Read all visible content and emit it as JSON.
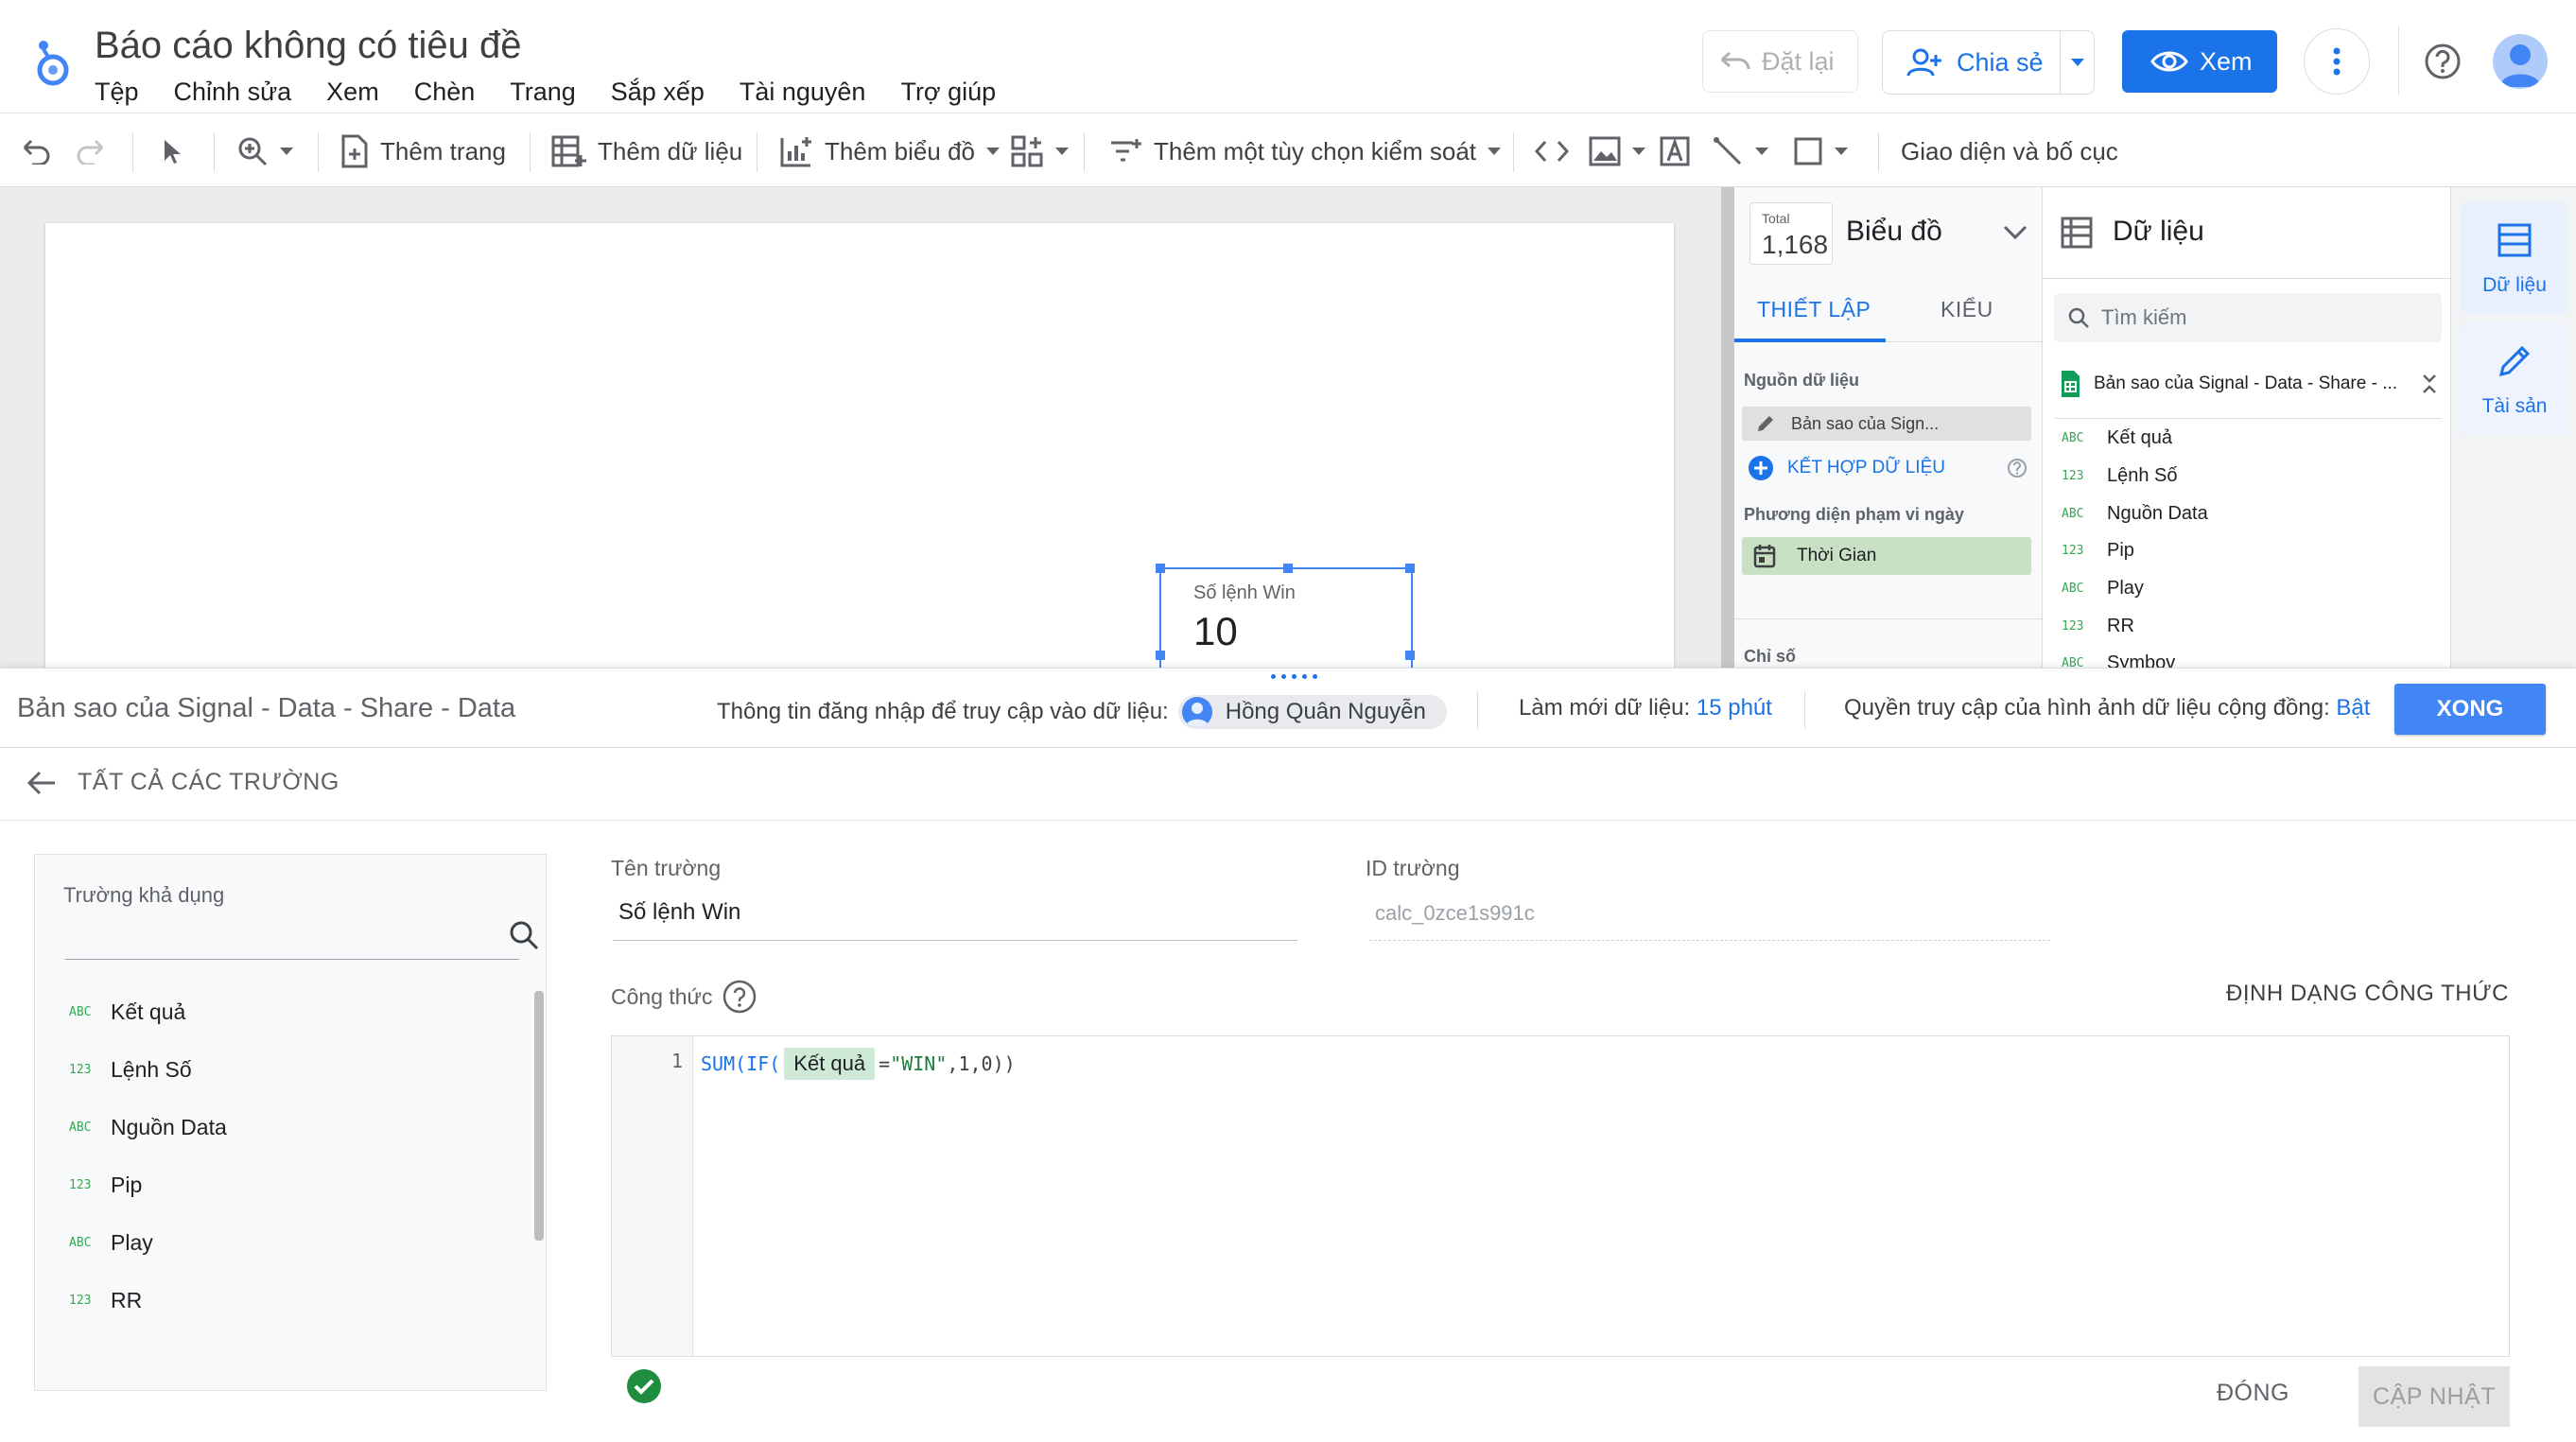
{
  "app": {
    "title": "Báo cáo không có tiêu đề",
    "menu": [
      "Tệp",
      "Chỉnh sửa",
      "Xem",
      "Chèn",
      "Trang",
      "Sắp xếp",
      "Tài nguyên",
      "Trợ giúp"
    ],
    "reset_label": "Đặt lại",
    "share_label": "Chia sẻ",
    "view_label": "Xem"
  },
  "toolbar": {
    "add_page": "Thêm trang",
    "add_data": "Thêm dữ liệu",
    "add_chart": "Thêm biểu đồ",
    "add_control": "Thêm một tùy chọn kiểm soát",
    "theme_layout": "Giao diện và bố cục"
  },
  "canvas": {
    "scorecard_label": "Số lệnh Win",
    "scorecard_value": "10"
  },
  "properties": {
    "total_label": "Total",
    "total_value": "1,168",
    "title": "Biểu đồ",
    "tab_setup": "THIẾT LẬP",
    "tab_style": "KIỂU",
    "datasource_label": "Nguồn dữ liệu",
    "datasource_value": "Bản sao của Sign...",
    "blend_label": "KẾT HỢP DỮ LIỆU",
    "date_range_label": "Phương diện phạm vi ngày",
    "date_range_value": "Thời Gian",
    "metric_label": "Chỉ số"
  },
  "data_panel": {
    "title": "Dữ liệu",
    "search_placeholder": "Tìm kiếm",
    "source_name": "Bản sao của Signal - Data - Share - ...",
    "fields": [
      {
        "type": "ABC",
        "name": "Kết quả"
      },
      {
        "type": "123",
        "name": "Lệnh Số"
      },
      {
        "type": "ABC",
        "name": "Nguồn Data"
      },
      {
        "type": "123",
        "name": "Pip"
      },
      {
        "type": "ABC",
        "name": "Play"
      },
      {
        "type": "123",
        "name": "RR"
      },
      {
        "type": "ABC",
        "name": "Symbov"
      }
    ]
  },
  "rail": {
    "data_label": "Dữ liệu",
    "assets_label": "Tài sản"
  },
  "editor": {
    "source_name": "Bản sao của Signal - Data - Share - Data",
    "credentials_label": "Thông tin đăng nhập để truy cập vào dữ liệu:",
    "user_name": "Hồng Quân Nguyễn",
    "refresh_label": "Làm mới dữ liệu:",
    "refresh_value": "15 phút",
    "access_label": "Quyền truy cập của hình ảnh dữ liệu cộng đồng:",
    "access_value": "Bật",
    "done_label": "XONG",
    "back_label": "TẤT CẢ CÁC TRƯỜNG",
    "available_label": "Trường khả dụng",
    "available_fields": [
      {
        "type": "ABC",
        "name": "Kết quả"
      },
      {
        "type": "123",
        "name": "Lệnh Số"
      },
      {
        "type": "ABC",
        "name": "Nguồn Data"
      },
      {
        "type": "123",
        "name": "Pip"
      },
      {
        "type": "ABC",
        "name": "Play"
      },
      {
        "type": "123",
        "name": "RR"
      }
    ],
    "field_name_label": "Tên trường",
    "field_name_value": "Số lệnh Win",
    "field_id_label": "ID trường",
    "field_id_value": "calc_0zce1s991c",
    "formula_label": "Công thức",
    "format_formula_label": "ĐỊNH DẠNG CÔNG THỨC",
    "line_number": "1",
    "formula": {
      "fn": "SUM(IF(",
      "field": "Kết quả",
      "eq": "=",
      "str": "\"WIN\"",
      "rest": ",1,0))"
    },
    "close_label": "ĐÓNG",
    "update_label": "CẬP NHẬT"
  },
  "colors": {
    "accent": "#1a73e8",
    "valid": "#1e8e3e",
    "field_chip": "#ceead6"
  }
}
